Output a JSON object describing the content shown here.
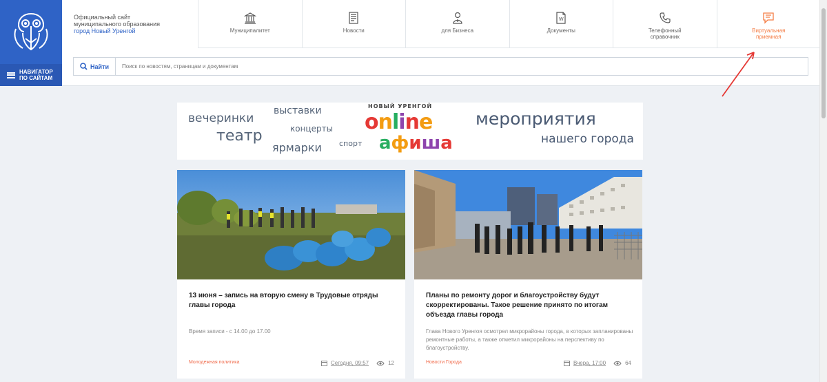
{
  "header": {
    "site_title_line1": "Официальный сайт",
    "site_title_line2": "муниципального образования",
    "site_title_city": "город Новый Уренгой",
    "navigator_label": "Навигатор по сайтам",
    "menu": [
      {
        "label": "Муниципалитет",
        "icon": "building-icon"
      },
      {
        "label": "Новости",
        "icon": "newspaper-icon"
      },
      {
        "label": "для Бизнеса",
        "icon": "person-icon"
      },
      {
        "label": "Документы",
        "icon": "document-icon"
      },
      {
        "label": "Телефонный справочник",
        "icon": "phone-icon"
      },
      {
        "label": "Виртуальная приемная",
        "icon": "chat-icon"
      }
    ],
    "accent_color": "#f47c44",
    "brand_color": "#2f63c6"
  },
  "search": {
    "button_label": "Найти",
    "placeholder": "Поиск по новостям, страницам и документам"
  },
  "banner": {
    "words": [
      "вечеринки",
      "театр",
      "выставки",
      "концерты",
      "ярмарки",
      "спорт"
    ],
    "logo_top": "НОВЫЙ УРЕНГОЙ",
    "logo_online": "online",
    "logo_afisha": "афиша",
    "tagline_1": "мероприятия",
    "tagline_2": "нашего города"
  },
  "news": [
    {
      "title": "13 июня – запись на вторую смену в Трудовые отряды главы города",
      "text": "Время записи - с 14.00 до 17.00",
      "category": "Молодежная политика",
      "date": "Сегодня, 09:57",
      "views": "12"
    },
    {
      "title": "Планы по ремонту дорог и благоустройству будут скорректированы. Такое решение принято по итогам объезда главы города",
      "text": "Глава Нового Уренгоя осмотрел микрорайоны города, в которых запланированы ремонтные работы, а также отметил микрорайоны на перспективу по благоустройству.",
      "category": "Новости Города",
      "date": "Вчера, 17:00",
      "views": "64"
    }
  ]
}
